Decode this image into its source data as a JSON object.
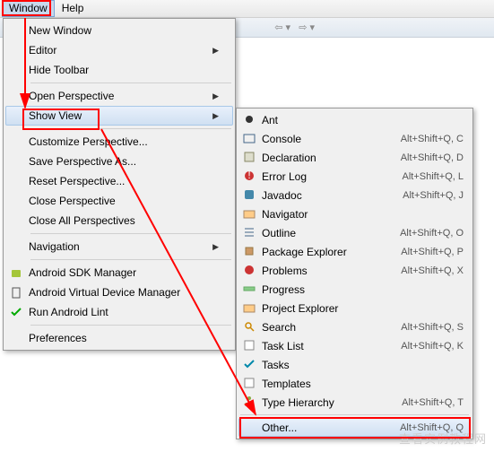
{
  "menubar": {
    "window": "Window",
    "help": "Help"
  },
  "window_menu": {
    "new_window": "New Window",
    "editor": "Editor",
    "hide_toolbar": "Hide Toolbar",
    "open_perspective": "Open Perspective",
    "show_view": "Show View",
    "customize": "Customize Perspective...",
    "save_as": "Save Perspective As...",
    "reset": "Reset Perspective...",
    "close": "Close Perspective",
    "close_all": "Close All Perspectives",
    "navigation": "Navigation",
    "sdk_manager": "Android SDK Manager",
    "avd_manager": "Android Virtual Device Manager",
    "run_lint": "Run Android Lint",
    "preferences": "Preferences"
  },
  "show_view_menu": {
    "ant": "Ant",
    "console": "Console",
    "declaration": "Declaration",
    "error_log": "Error Log",
    "javadoc": "Javadoc",
    "navigator": "Navigator",
    "outline": "Outline",
    "package_explorer": "Package Explorer",
    "problems": "Problems",
    "progress": "Progress",
    "project_explorer": "Project Explorer",
    "search": "Search",
    "task_list": "Task List",
    "tasks": "Tasks",
    "templates": "Templates",
    "type_hierarchy": "Type Hierarchy",
    "other": "Other..."
  },
  "shortcuts": {
    "console": "Alt+Shift+Q, C",
    "declaration": "Alt+Shift+Q, D",
    "error_log": "Alt+Shift+Q, L",
    "javadoc": "Alt+Shift+Q, J",
    "outline": "Alt+Shift+Q, O",
    "package_explorer": "Alt+Shift+Q, P",
    "problems": "Alt+Shift+Q, X",
    "search": "Alt+Shift+Q, S",
    "task_list": "Alt+Shift+Q, K",
    "type_hierarchy": "Alt+Shift+Q, T",
    "other": "Alt+Shift+Q, Q"
  },
  "watermark": "查看实例教程网"
}
